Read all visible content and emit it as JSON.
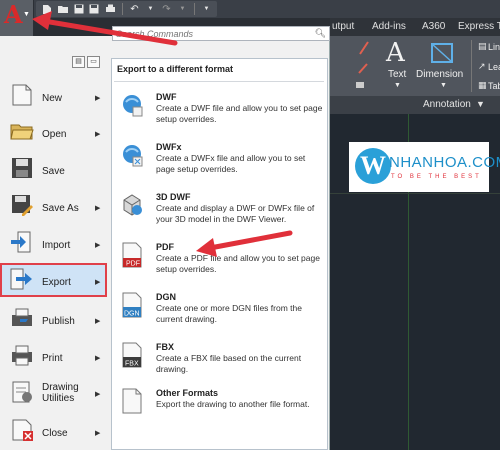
{
  "qat": {
    "icons": [
      "new-icon",
      "open-icon",
      "save-icon",
      "save-as-icon",
      "print-icon",
      "undo-icon",
      "redo-icon",
      "dropdown-icon"
    ]
  },
  "ribbon_tabs": [
    "utput",
    "Add-ins",
    "A360",
    "Express To"
  ],
  "search": {
    "placeholder": "Search Commands"
  },
  "menu": {
    "items": [
      {
        "label": "New",
        "icon": "new-document-icon",
        "chevron": true
      },
      {
        "label": "Open",
        "icon": "open-folder-icon",
        "chevron": true
      },
      {
        "label": "Save",
        "icon": "save-floppy-icon",
        "chevron": false
      },
      {
        "label": "Save As",
        "icon": "save-as-icon",
        "chevron": true
      },
      {
        "label": "Import",
        "icon": "import-icon",
        "chevron": true
      },
      {
        "label": "Export",
        "icon": "export-icon",
        "chevron": true
      },
      {
        "label": "Publish",
        "icon": "publish-icon",
        "chevron": true
      },
      {
        "label": "Print",
        "icon": "printer-icon",
        "chevron": true
      },
      {
        "label": "Drawing",
        "label2": "Utilities",
        "icon": "drawing-utilities-icon",
        "chevron": true
      },
      {
        "label": "Close",
        "icon": "close-icon",
        "chevron": true
      }
    ],
    "active": "Export"
  },
  "export_panel": {
    "title": "Export to a different format",
    "options": [
      {
        "title": "DWF",
        "desc": "Create a DWF file and allow you to set page setup overrides.",
        "icon": "dwf-icon"
      },
      {
        "title": "DWFx",
        "desc": "Create a DWFx file and allow you to set page setup overrides.",
        "icon": "dwfx-icon"
      },
      {
        "title": "3D DWF",
        "desc": "Create and display a DWF or DWFx file of your 3D model in the DWF Viewer.",
        "icon": "3d-dwf-icon"
      },
      {
        "title": "PDF",
        "desc": "Create a PDF file and allow you to set page setup overrides.",
        "icon": "pdf-icon"
      },
      {
        "title": "DGN",
        "desc": "Create one or more DGN files from the current drawing.",
        "icon": "dgn-icon"
      },
      {
        "title": "FBX",
        "desc": "Create a FBX file based on the current drawing.",
        "icon": "fbx-icon"
      },
      {
        "title": "Other Formats",
        "desc": "Export the drawing to another file format.",
        "icon": "other-formats-icon"
      }
    ]
  },
  "ribbon": {
    "buttons": [
      {
        "label": "Text",
        "icon": "text-icon"
      },
      {
        "label": "Dimension",
        "icon": "dimension-icon"
      }
    ],
    "small": [
      "Line",
      "Lea",
      "Tab"
    ],
    "panel_label": "Annotation"
  },
  "watermark": {
    "brand": "NHANHOA.COM",
    "tagline": "TO BE THE BEST",
    "letter": "W"
  },
  "colors": {
    "accent_red": "#e0303a",
    "menu_bg": "#f1f1f1",
    "canvas_bg": "#212830",
    "active_bg": "#cfe3f6"
  }
}
